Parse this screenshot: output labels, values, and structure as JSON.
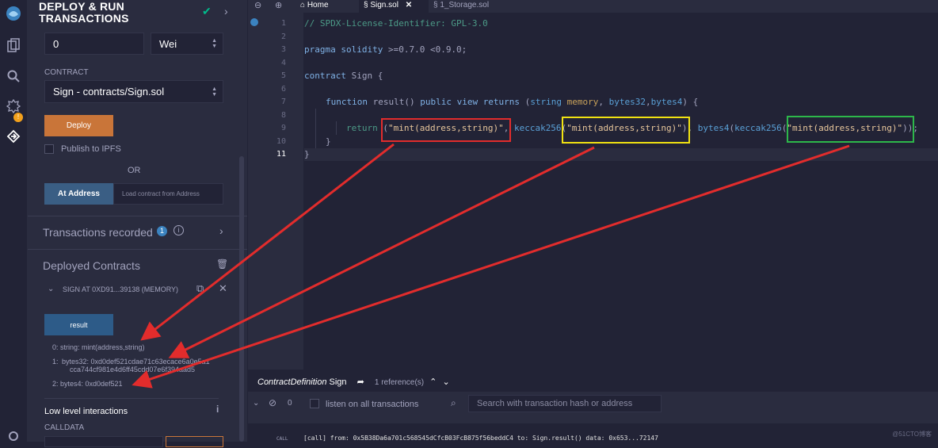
{
  "panel": {
    "title": "DEPLOY & RUN TRANSACTIONS",
    "value_input": "0",
    "unit": "Wei",
    "contract_label": "CONTRACT",
    "contract_selected": "Sign - contracts/Sign.sol",
    "deploy_label": "Deploy",
    "publish_label": "Publish to IPFS",
    "or_label": "OR",
    "at_address_label": "At Address",
    "at_address_placeholder": "Load contract from Address",
    "transactions_label": "Transactions recorded",
    "transactions_count": "1",
    "deployed_label": "Deployed Contracts",
    "instance_label": "SIGN AT 0XD91...39138 (MEMORY)",
    "result_button": "result",
    "output_0": "0: string: mint(address,string)",
    "output_1_prefix": "1:",
    "output_1_line1": "bytes32: 0xd0def521cdae71c63ecace6a0e5a1",
    "output_1_line2": "cca744cf981e4d6ff45cdd07e6f394aad5",
    "output_2": "2: bytes4: 0xd0def521",
    "low_level_label": "Low level interactions",
    "calldata_label": "CALLDATA"
  },
  "tabs": {
    "home": "Home",
    "sign": "Sign.sol",
    "storage": "1_Storage.sol"
  },
  "editor": {
    "line_numbers": [
      "1",
      "2",
      "3",
      "4",
      "5",
      "6",
      "7",
      "8",
      "9",
      "10",
      "11"
    ],
    "l1": "// SPDX-License-Identifier: GPL-3.0",
    "l3_kw": "pragma solidity",
    "l3_rest": " >=0.7.0 <0.9.0;",
    "l5_kw": "contract",
    "l5_rest": " Sign {",
    "l7_kw1": "function",
    "l7_name": " result() ",
    "l7_kw2": "public view returns",
    "l7_p1": " (",
    "l7_t1": "string",
    "l7_m": " memory",
    "l7_p2": ", ",
    "l7_t2": "bytes32",
    "l7_p3": ",",
    "l7_t3": "bytes4",
    "l7_p4": ") {",
    "l9_ret": "return",
    "l9_a": " (",
    "l9_s1": "\"mint(address,string)\"",
    "l9_b": ", ",
    "l9_kec1": "keccak256",
    "l9_c": "(",
    "l9_s2": "\"mint(address,string)\"",
    "l9_d": "), ",
    "l9_b4": "bytes4",
    "l9_e": "(",
    "l9_kec2": "keccak256",
    "l9_f": "(",
    "l9_s3": "\"mint(address,string)\"",
    "l9_g": "));",
    "l10": "}",
    "l11": "}"
  },
  "bottom": {
    "definition_italic": "ContractDefinition",
    "definition_name": " Sign",
    "references": "1 reference(s)",
    "pending_count": "0",
    "listen_label": "listen on all transactions",
    "search_placeholder": "Search with transaction hash or address",
    "terminal_tag": "CALL",
    "terminal_line": "[call]  from: 0x5B38Da6a701c568545dCfcB03FcB875f56beddC4 to: Sign.result() data: 0x653...72147"
  },
  "watermark": "@51CTO博客",
  "colors": {
    "accent_orange": "#c97539",
    "accent_blue": "#2d5b88",
    "highlight_red": "#e22c2c",
    "highlight_yellow": "#f0e212",
    "highlight_green": "#2db74a"
  }
}
